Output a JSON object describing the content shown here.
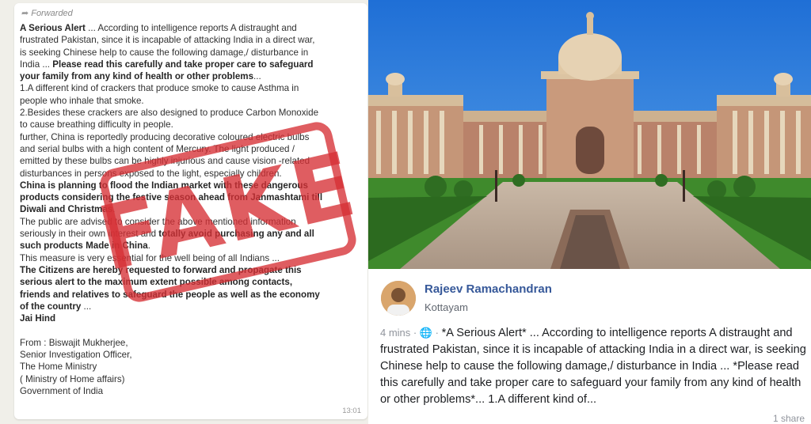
{
  "whatsapp": {
    "forwarded_label": "Forwarded",
    "lines": [
      {
        "parts": [
          {
            "t": "A Serious Alert",
            "b": true
          },
          {
            "t": " ...  According to intelligence reports A distraught and",
            "b": false
          }
        ]
      },
      {
        "parts": [
          {
            "t": "frustrated Pakistan, since it is incapable of attacking India in a direct war,",
            "b": false
          }
        ]
      },
      {
        "parts": [
          {
            "t": "is seeking Chinese help to cause the following damage,/ disturbance in",
            "b": false
          }
        ]
      },
      {
        "parts": [
          {
            "t": "India ... ",
            "b": false
          },
          {
            "t": "Please read this carefully and take proper care to safeguard",
            "b": true
          }
        ]
      },
      {
        "parts": [
          {
            "t": "your family from any kind of health or other problems",
            "b": true
          },
          {
            "t": "...",
            "b": false
          }
        ]
      },
      {
        "parts": [
          {
            "t": "1.A different kind of crackers that produce smoke to cause Asthma in",
            "b": false
          }
        ]
      },
      {
        "parts": [
          {
            "t": "people who inhale that smoke.",
            "b": false
          }
        ]
      },
      {
        "parts": [
          {
            "t": "2.Besides these crackers are also designed to produce Carbon Monoxide",
            "b": false
          }
        ]
      },
      {
        "parts": [
          {
            "t": "to cause breathing difficulty in people.",
            "b": false
          }
        ]
      },
      {
        "parts": [
          {
            "t": "further, China is reportedly producing decorative coloured electric bulbs",
            "b": false
          }
        ]
      },
      {
        "parts": [
          {
            "t": "and serial bulbs with a high content of Mercury. The light produced /",
            "b": false
          }
        ]
      },
      {
        "parts": [
          {
            "t": "emitted by these bulbs can be highly injurious and cause vision -related",
            "b": false
          }
        ]
      },
      {
        "parts": [
          {
            "t": "disturbances in persons exposed to the light, especially children.",
            "b": false
          }
        ]
      },
      {
        "parts": [
          {
            "t": "China is planning to flood the Indian market with these dangerous",
            "b": true
          }
        ]
      },
      {
        "parts": [
          {
            "t": "products considering the festive season ahead from Janmashtami till",
            "b": true
          }
        ]
      },
      {
        "parts": [
          {
            "t": "Diwali and Christmas",
            "b": true
          },
          {
            "t": ".",
            "b": false
          }
        ]
      },
      {
        "parts": [
          {
            "t": "The public are advised to consider the above mentioned information",
            "b": false
          }
        ]
      },
      {
        "parts": [
          {
            "t": "seriously in their own interest and ",
            "b": false
          },
          {
            "t": "totally avoid purchasing any and all",
            "b": true
          }
        ]
      },
      {
        "parts": [
          {
            "t": "such products Made in China",
            "b": true
          },
          {
            "t": ".",
            "b": false
          }
        ]
      },
      {
        "parts": [
          {
            "t": "This measure is very essential for the well being of all Indians ...",
            "b": false
          }
        ]
      },
      {
        "parts": [
          {
            "t": "The Citizens are hereby requested to forward and propagate this",
            "b": true
          }
        ]
      },
      {
        "parts": [
          {
            "t": "serious alert to the maximum extent possible among contacts,",
            "b": true
          }
        ]
      },
      {
        "parts": [
          {
            "t": "friends and relatives to safeguard the people as well as the economy",
            "b": true
          }
        ]
      },
      {
        "parts": [
          {
            "t": "of the country",
            "b": true
          },
          {
            "t": " ...",
            "b": false
          }
        ]
      },
      {
        "parts": [
          {
            "t": "Jai Hind",
            "b": true
          }
        ]
      },
      {
        "parts": []
      },
      {
        "parts": [
          {
            "t": "From : Biswajit Mukherjee,",
            "b": false
          }
        ]
      },
      {
        "parts": [
          {
            "t": "Senior Investigation Officer,",
            "b": false
          }
        ]
      },
      {
        "parts": [
          {
            "t": "The Home Ministry",
            "b": false
          }
        ]
      },
      {
        "parts": [
          {
            "t": "( Ministry of Home affairs)",
            "b": false
          }
        ]
      },
      {
        "parts": [
          {
            "t": "Government of India",
            "b": false
          }
        ]
      }
    ],
    "time": "13:01",
    "stamp_text": "FAKE"
  },
  "colors": {
    "stamp": "#d63034",
    "fb_name": "#365899",
    "fb_text": "#1c1e21",
    "fb_meta": "#90949c"
  },
  "facebook": {
    "author": "Rajeev Ramachandran",
    "location": "Kottayam",
    "time": "4 mins",
    "separator": " · ",
    "privacy_icon": "globe-icon",
    "text": "*A Serious Alert* ... According to intelligence reports A distraught and frustrated Pakistan, since it is incapable of attacking India in a direct war, is seeking Chinese help to cause the following damage,/ disturbance in India ... *Please read this carefully and take proper care to safeguard your family from any kind of health or other problems*... 1.A different kind of...",
    "shares": "1 share"
  }
}
